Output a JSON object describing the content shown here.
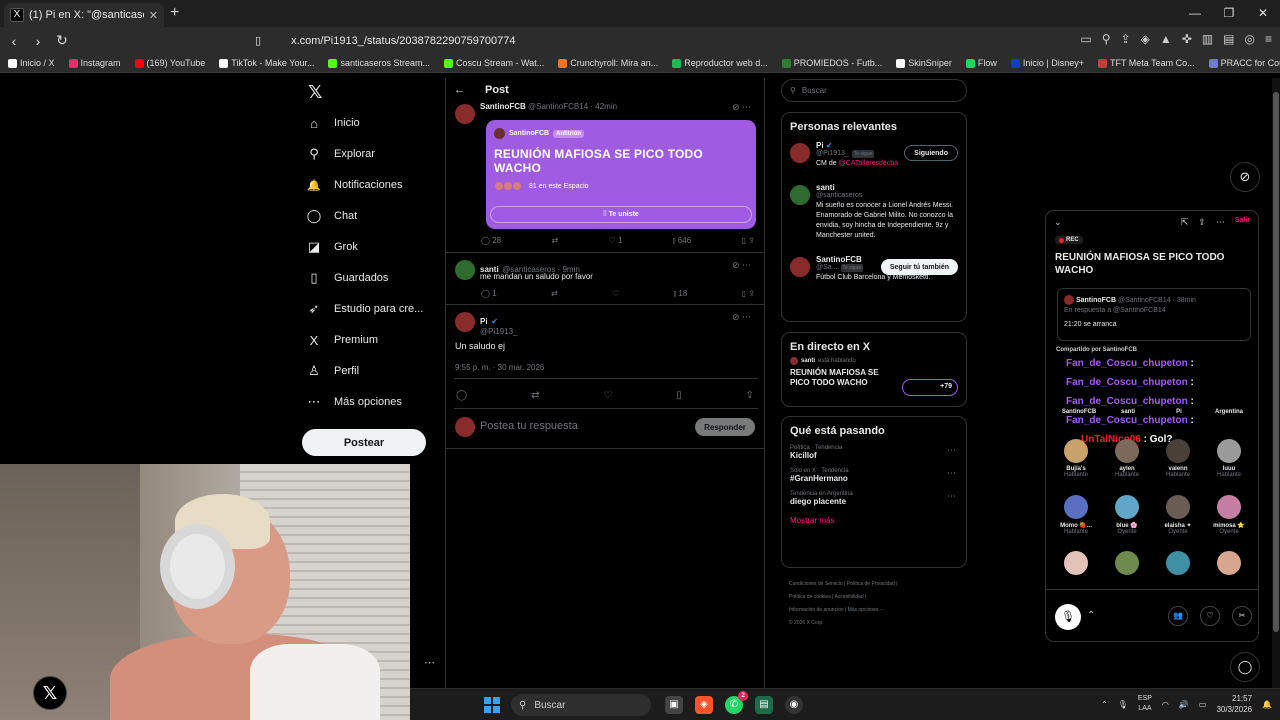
{
  "browser": {
    "tab_title": "(1) Pi en X: \"@santicaseros @",
    "url": "x.com/Pi1913_/status/2038782290759700774",
    "bookmarks": [
      "Inicio / X",
      "Instagram",
      "(169) YouTube",
      "TikTok - Make Your...",
      "santicaseros Stream...",
      "Coscu Stream - Wat...",
      "Crunchyroll: Mira an...",
      "Reproductor web d...",
      "PROMIEDOS - Futb...",
      "SkinSniper",
      "Flow",
      "Inicio | Disney+",
      "TFT Meta Team Co...",
      "PRACC for Counter-..."
    ],
    "bookmark_colors": [
      "#ffffff",
      "#e1306c",
      "#ff0000",
      "#ffffff",
      "#53fc18",
      "#53fc18",
      "#f47521",
      "#1db954",
      "#2e7d32",
      "#ffffff",
      "#1ed760",
      "#113ccf",
      "#c93b3b",
      "#6b7bd6"
    ]
  },
  "leftnav": {
    "items": [
      {
        "label": "Inicio",
        "icon": "⌂"
      },
      {
        "label": "Explorar",
        "icon": "⚲"
      },
      {
        "label": "Notificaciones",
        "icon": "🔔"
      },
      {
        "label": "Chat",
        "icon": "◯"
      },
      {
        "label": "Grok",
        "icon": "◪"
      },
      {
        "label": "Guardados",
        "icon": "▯"
      },
      {
        "label": "Estudio para cre...",
        "icon": "➶"
      },
      {
        "label": "Premium",
        "icon": "X"
      },
      {
        "label": "Perfil",
        "icon": "♙"
      },
      {
        "label": "Más opciones",
        "icon": "⋯"
      }
    ],
    "post_button": "Postear"
  },
  "center": {
    "header": "Post",
    "tweet1": {
      "name": "SantinoFCB",
      "handle_time": "@SantinoFCB14 · 42min",
      "space": {
        "host": "SantinoFCB",
        "host_badge": "Anfitrión",
        "title": "REUNIÓN MAFIOSA SE PICO TODO WACHO",
        "listeners": "81 en este Espacio",
        "join_label": "Te uniste"
      },
      "stats": {
        "replies": "28",
        "retweets": "",
        "likes": "1",
        "views": "646"
      }
    },
    "tweet2": {
      "name": "santi",
      "handle_time": "@santicaseros · 9min",
      "text": "me mandan un saludo por favor",
      "stats": {
        "replies": "1",
        "views": "18"
      }
    },
    "tweet3": {
      "name": "Pi",
      "handle": "@Pi1913_",
      "text": "Un saludo ej",
      "timestamp": "9:55 p. m. · 30 mar. 2026"
    },
    "reply": {
      "placeholder": "Postea tu respuesta",
      "button": "Responder"
    }
  },
  "right": {
    "search_placeholder": "Buscar",
    "relevant": {
      "title": "Personas relevantes",
      "people": [
        {
          "name": "Pi",
          "handle": "@Pi1913_",
          "tag": "Te sigue",
          "bio_pre": "CM de ",
          "bio_link": "@CATalleresdecba",
          "button": "Siguiendo"
        },
        {
          "name": "santi",
          "handle": "@santicaseros",
          "bio": "Mi sueño es conocer a Lionel Andrés Messi. Enamorado de Gabriel Milito. No conozco la envidia, soy hincha de Independiente. 9z y Manchester united."
        },
        {
          "name": "SantinoFCB",
          "handle": "@Sa...",
          "tag": "Te sigue",
          "bio": "Fútbol Club Barcelona y Memosketti.",
          "button": "Seguir tú también"
        }
      ]
    },
    "live": {
      "title": "En directo en X",
      "host_line": "santi",
      "host_status": "está hablando",
      "space_title": "REUNIÓN MAFIOSA SE PICO TODO WACHO",
      "count": "+79"
    },
    "trends": {
      "title": "Qué está pasando",
      "items": [
        {
          "category": "Política · Tendencia",
          "name": "Kicillof"
        },
        {
          "category": "Solo en X · Tendencia",
          "name": "#GranHermano"
        },
        {
          "category": "Tendencia en Argentina",
          "name": "diego placente"
        }
      ],
      "more": "Mostrar más"
    },
    "footer": [
      "Condiciones de Servicio",
      "Política de Privacidad",
      "Política de cookies",
      "Accesibilidad",
      "Información de anuncios",
      "Más opciones ···",
      "© 2026 X Corp."
    ]
  },
  "dock": {
    "leave": "Salir",
    "rec": "REC",
    "title": "REUNIÓN MAFIOSA SE PICO TODO WACHO",
    "pinned": {
      "name": "SantinoFCB",
      "handle_time": "@SantinoFCB14 · 38min",
      "reply_to": "En respuesta a @SantinoFCB14",
      "text": "21:20 se arranca"
    },
    "shared_by": "Compartido por SantinoFCB",
    "chat": [
      {
        "user": "Fan_de_Coscu_chupeton",
        "msg": ":"
      },
      {
        "user": "Fan_de_Coscu_chupeton",
        "msg": ":"
      },
      {
        "user": "Fan_de_Coscu_chupeton",
        "msg": ":"
      },
      {
        "user": "Fan_de_Coscu_chupeton",
        "msg": ":"
      },
      {
        "user": "UnTalNico06",
        "msg": ": Gol?"
      }
    ],
    "speaker_row0": [
      "SantinoFCB",
      "santi",
      "Pi",
      "Argentina"
    ],
    "speakers": [
      {
        "name": "Bujia's",
        "status": "Hablante"
      },
      {
        "name": "aylen",
        "status": "Hablante"
      },
      {
        "name": "valenn",
        "status": "Hablante"
      },
      {
        "name": "luuu",
        "status": "Hablante"
      },
      {
        "name": "Momo 🍓...",
        "status": "Hablante"
      },
      {
        "name": "blue 🌸",
        "status": "Oyente"
      },
      {
        "name": "elaisha ✦",
        "status": "Oyente"
      },
      {
        "name": "mimosa ⭐",
        "status": "Oyente"
      }
    ]
  },
  "taskbar": {
    "search": "Buscar",
    "lang1": "ESP",
    "lang2": "LAA",
    "time": "21:57",
    "date": "30/3/2026",
    "whatsapp_badge": "2"
  }
}
